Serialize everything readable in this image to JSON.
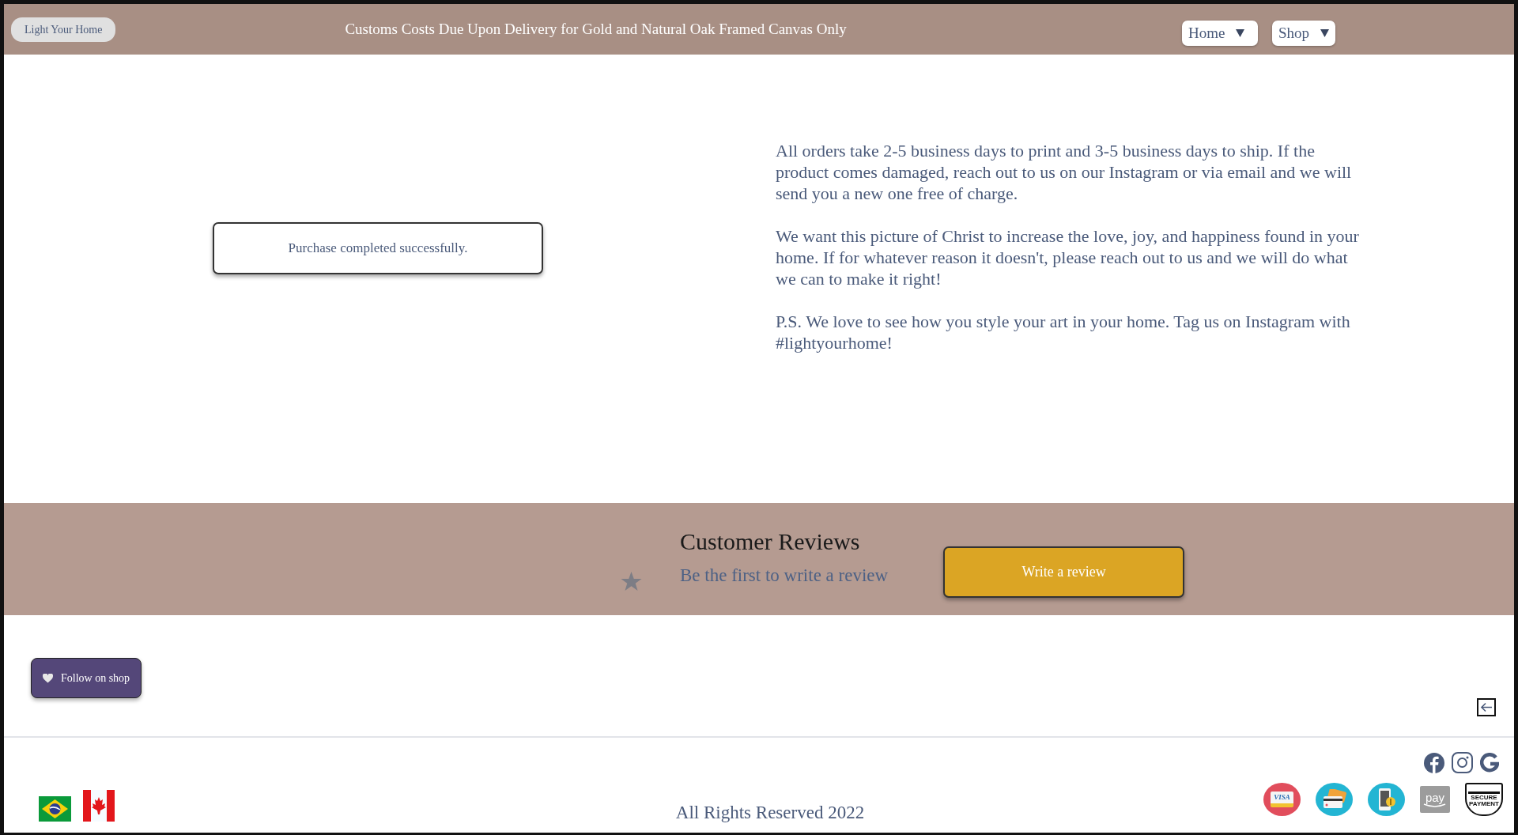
{
  "top_bar": {
    "brand": "Light Your Home",
    "announcement": "Customs Costs Due Upon Delivery for Gold and Natural Oak Framed Canvas Only",
    "menus": [
      {
        "label": "Home"
      },
      {
        "label": "Shop"
      }
    ]
  },
  "notice": {
    "message": "Purchase completed successfully."
  },
  "info_paragraphs": [
    "All orders take 2-5 business days to print and 3-5 business days to ship. If the product comes damaged, reach out to us on our Instagram or via email and we will send you a new one free of charge.",
    "We want this picture of Christ to increase the love, joy, and happiness found in your home. If for whatever reason it doesn't, please reach out to us and we will do what we can to make it right!",
    "P.S. We love to see how you style your art in your home. Tag us on Instagram with #lightyourhome!"
  ],
  "reviews": {
    "title": "Customer Reviews",
    "prompt": "Be the first to write a review",
    "button": "Write a review"
  },
  "follow_button": {
    "label": "Follow on shop"
  },
  "footer": {
    "copyright": "All Rights Reserved 2022",
    "payment_badges": [
      {
        "kind": "visa",
        "label": "VISA"
      },
      {
        "kind": "cards"
      },
      {
        "kind": "mobile"
      },
      {
        "kind": "amazon",
        "label": "pay"
      },
      {
        "kind": "secure",
        "label": "SECURE PAYMENT"
      }
    ]
  }
}
